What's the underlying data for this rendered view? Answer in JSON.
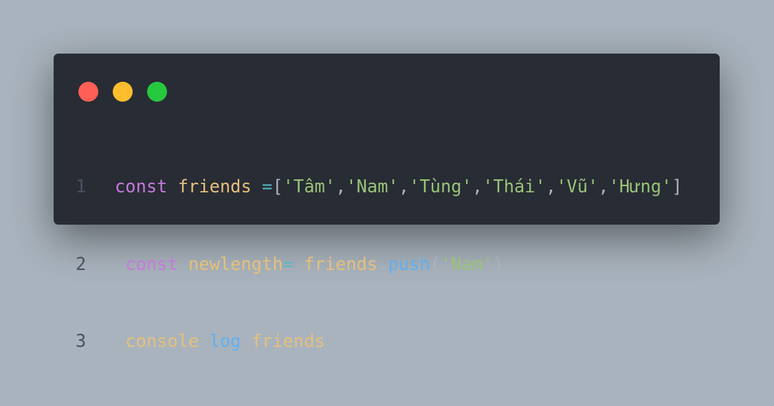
{
  "window_controls": {
    "close_color": "#ff5f56",
    "minimize_color": "#ffbd2e",
    "maximize_color": "#27c93f"
  },
  "code": {
    "lines": [
      {
        "number": "1",
        "text": "const friends =['Tâm','Nam','Tùng','Thái','Vũ','Hưng']"
      },
      {
        "number": "2",
        "text": " const newlength= friends.push('Nam')"
      },
      {
        "number": "3",
        "text": " console.log(friends)"
      }
    ]
  }
}
